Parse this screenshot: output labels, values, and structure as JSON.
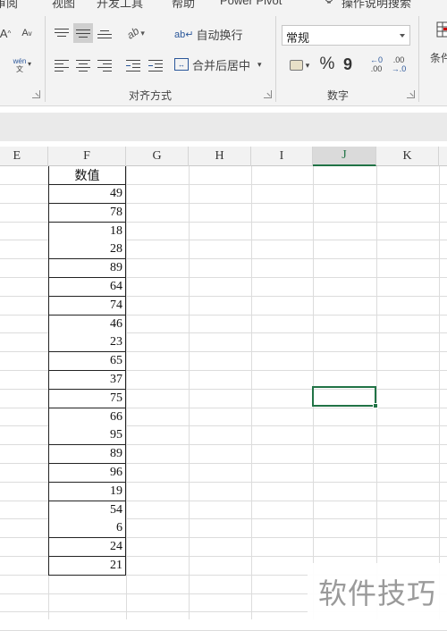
{
  "ribbon": {
    "menu_tabs": [
      "审阅",
      "视图",
      "开发工具",
      "帮助",
      "Power Pivot",
      "操作说明搜索"
    ],
    "alignment": {
      "increase_font": "A",
      "decrease_font": "A",
      "phonetic_top": "wén",
      "phonetic_bottom": "文",
      "orientation": "ab",
      "wrap_text": "自动换行",
      "merge_center": "合并后居中",
      "group_label": "对齐方式"
    },
    "number": {
      "format_value": "常规",
      "percent": "%",
      "comma": "9",
      "increase_decimal_top": "←0",
      "increase_decimal_bottom": ".00",
      "decrease_decimal_top": ".00",
      "decrease_decimal_bottom": "→.0",
      "group_label": "数字"
    },
    "styles": {
      "conditional_format_partial": "条件"
    }
  },
  "columns": [
    "E",
    "F",
    "G",
    "H",
    "I",
    "J",
    "K"
  ],
  "active_column": "J",
  "table": {
    "header": "数值",
    "values": [
      "49",
      "78",
      "18",
      "28",
      "89",
      "64",
      "74",
      "46",
      "23",
      "65",
      "37",
      "75",
      "66",
      "95",
      "89",
      "96",
      "19",
      "54",
      "6",
      "24",
      "21"
    ]
  },
  "watermark": "软件技巧",
  "colors": {
    "accent": "#217346",
    "ribbon_bg": "#f3f3f3",
    "merge_icon": "#2b579a"
  }
}
